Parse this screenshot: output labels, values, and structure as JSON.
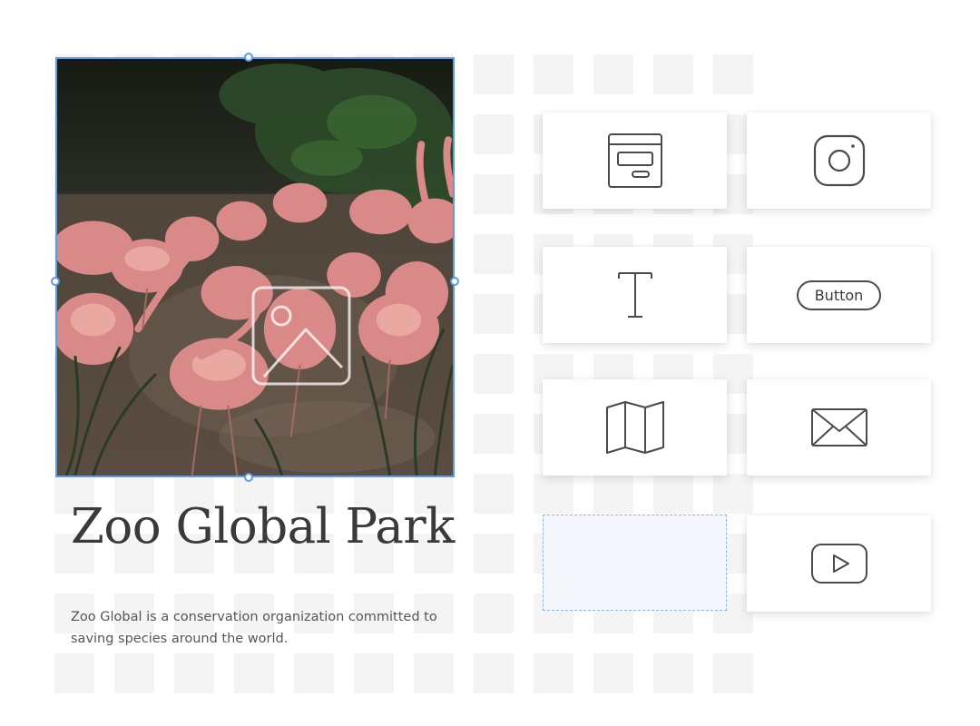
{
  "header": {
    "title": "Zoo Global Park"
  },
  "main": {
    "description": "Zoo Global is a conservation organization committed to saving species around the world.",
    "selected_image": {
      "subject": "flamingos"
    }
  },
  "palette": {
    "items": [
      {
        "name": "layout-block",
        "icon": "layout-block-icon"
      },
      {
        "name": "instagram",
        "icon": "instagram-icon"
      },
      {
        "name": "text",
        "icon": "text-icon"
      },
      {
        "name": "button",
        "label": "Button"
      },
      {
        "name": "map",
        "icon": "map-icon"
      },
      {
        "name": "email",
        "icon": "envelope-icon"
      },
      {
        "name": "drop-target"
      },
      {
        "name": "video",
        "icon": "youtube-icon"
      }
    ]
  },
  "colors": {
    "selection": "#5b9bea",
    "drop_zone_border": "#8ab8ee",
    "drop_zone_fill": "#f3f6fa",
    "icon_stroke": "#4a4a4a",
    "title": "#3a3a3a"
  }
}
